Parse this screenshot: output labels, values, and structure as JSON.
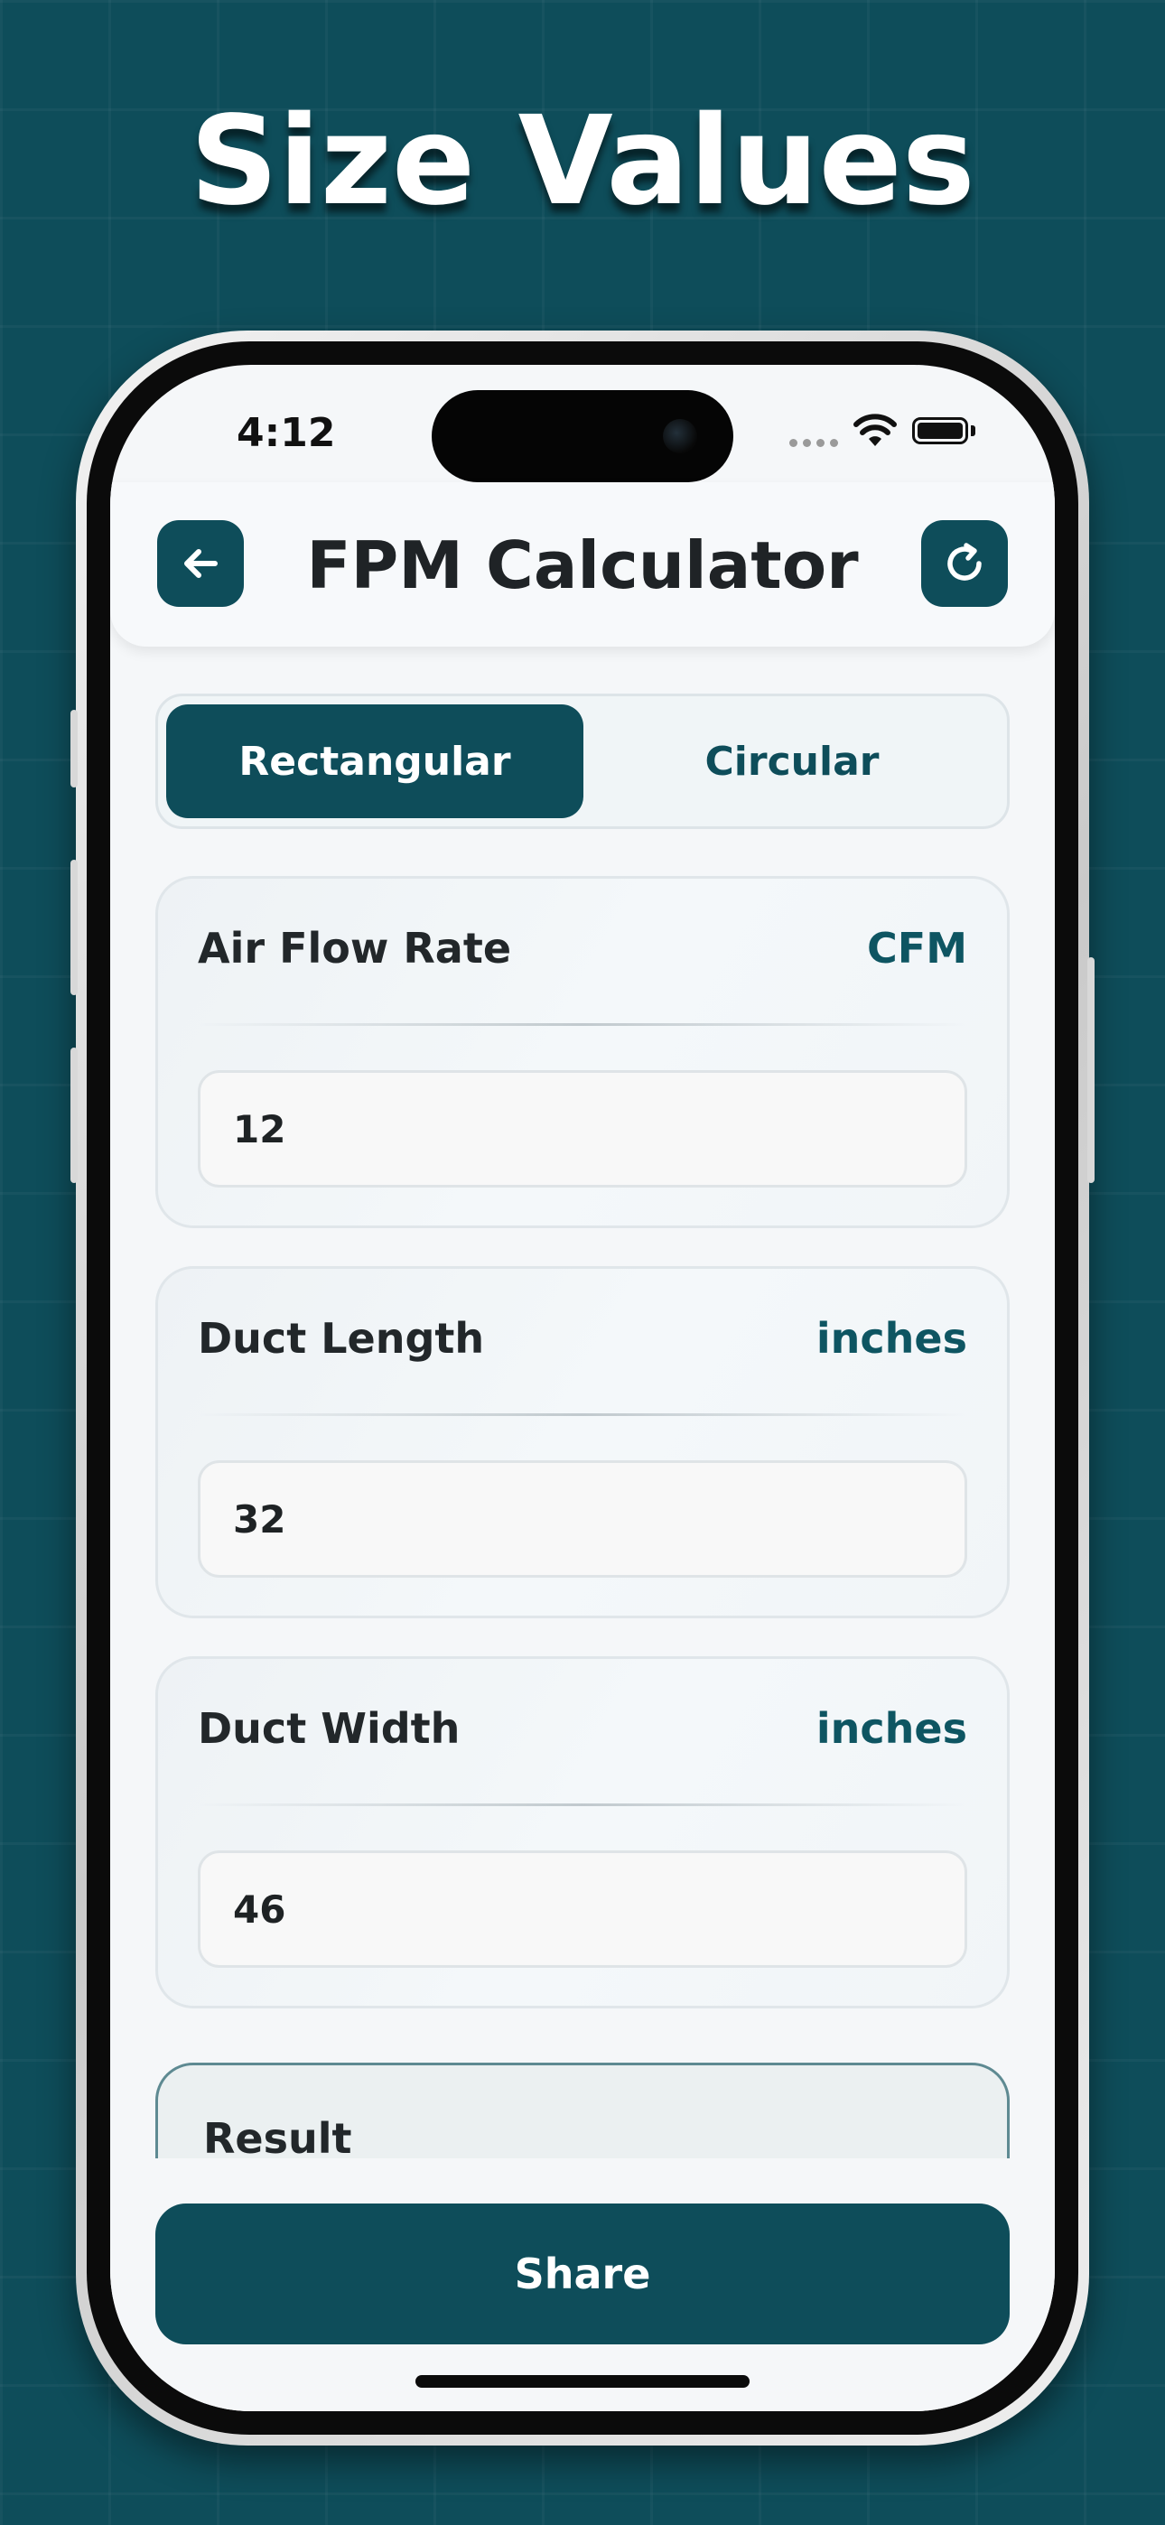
{
  "promo": {
    "headline": "Size Values"
  },
  "status_bar": {
    "time": "4:12"
  },
  "header": {
    "title": "FPM Calculator",
    "back_icon": "arrow-left-icon",
    "refresh_icon": "refresh-icon"
  },
  "segments": [
    {
      "label": "Rectangular",
      "selected": true
    },
    {
      "label": "Circular",
      "selected": false
    }
  ],
  "fields": [
    {
      "label": "Air Flow Rate",
      "unit": "CFM",
      "value": "12"
    },
    {
      "label": "Duct Length",
      "unit": "inches",
      "value": "32"
    },
    {
      "label": "Duct Width",
      "unit": "inches",
      "value": "46"
    }
  ],
  "result": {
    "label": "Result"
  },
  "share": {
    "label": "Share"
  },
  "colors": {
    "primary": "#0e4d5a",
    "background": "#0e4d5a",
    "screen": "#f5f7f9",
    "text": "#1f2326"
  }
}
